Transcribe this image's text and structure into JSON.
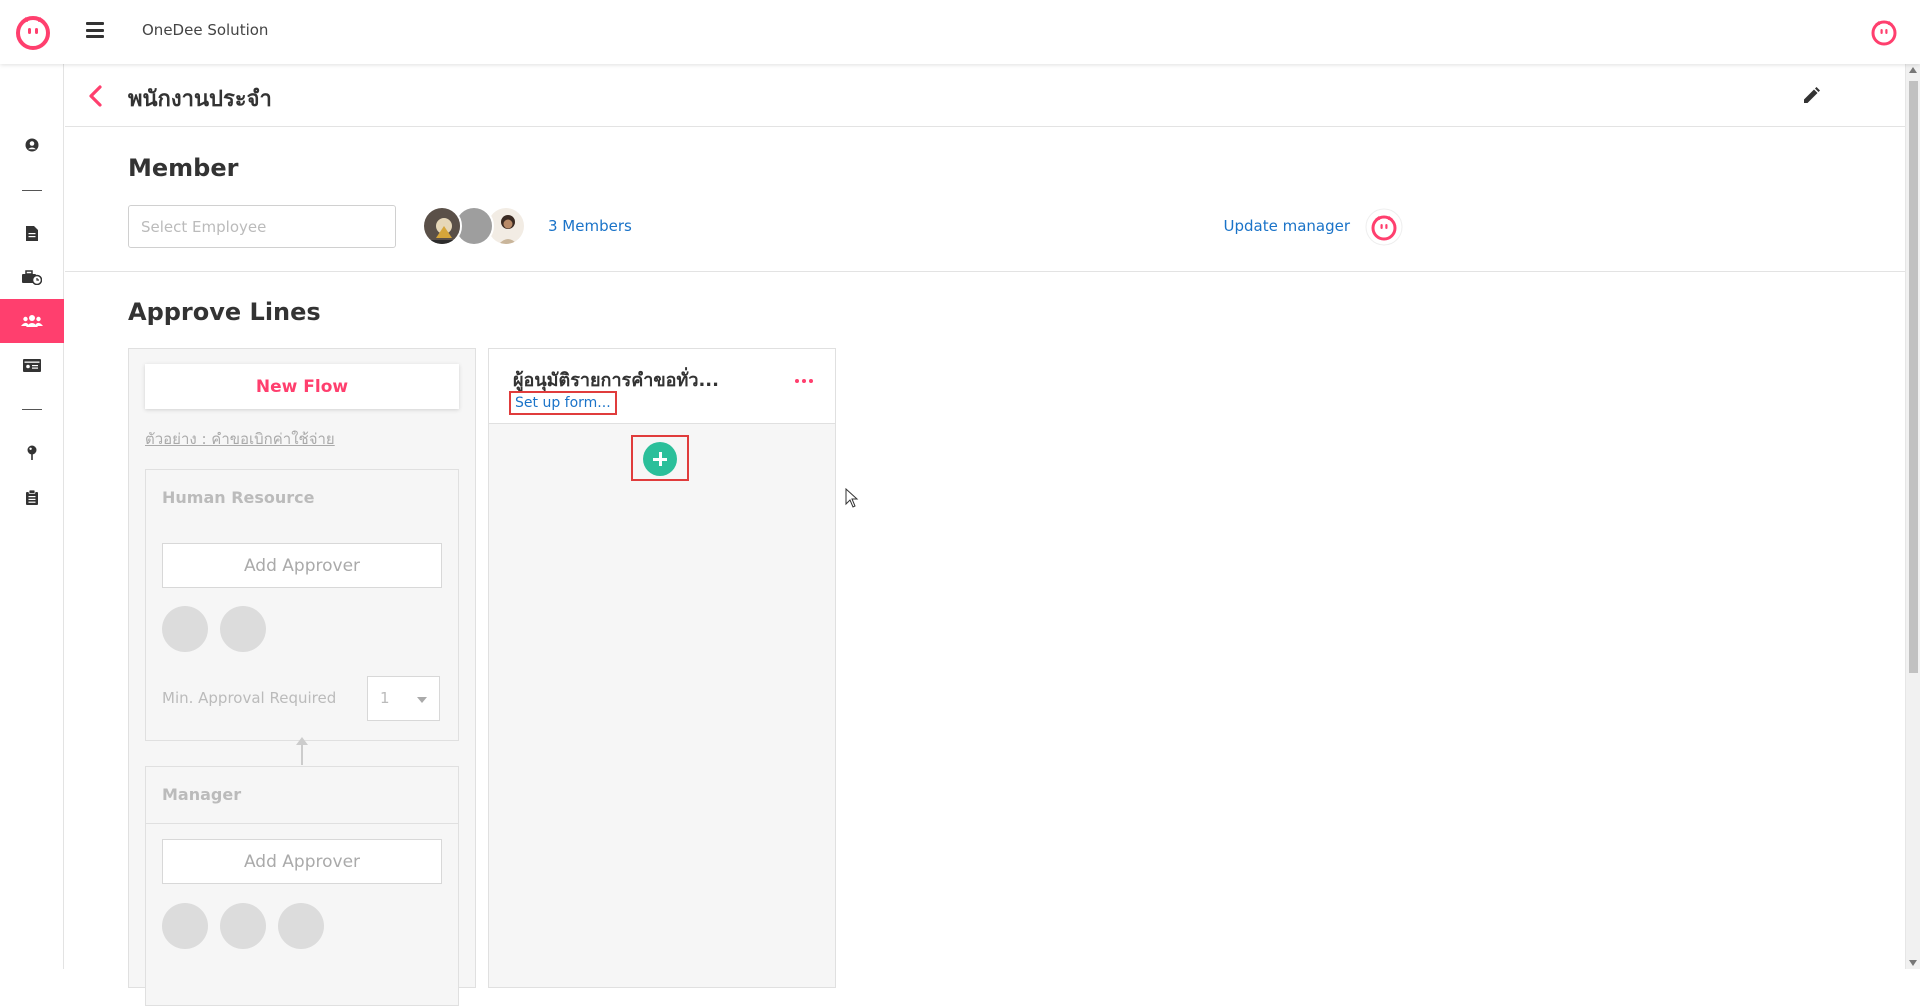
{
  "app": {
    "title": "OneDee Solution",
    "brand_color": "#ff3f6e",
    "accent_green": "#2bbf9a",
    "link_color": "#1a73c8"
  },
  "topbar": {
    "logo_icon": "pink-face-logo",
    "menu_icon": "hamburger-menu-icon",
    "user_icon": "pink-face-avatar"
  },
  "sidebar": {
    "items": [
      {
        "icon": "user-circle-icon",
        "active": false
      },
      {
        "icon": "document-icon",
        "active": false
      },
      {
        "icon": "briefcase-clock-icon",
        "active": false
      },
      {
        "icon": "users-group-icon",
        "active": true
      },
      {
        "icon": "id-card-icon",
        "active": false
      },
      {
        "icon": "map-pin-icon",
        "active": false
      },
      {
        "icon": "clipboard-icon",
        "active": false
      }
    ]
  },
  "page": {
    "title": "พนักงานประจำ"
  },
  "member": {
    "heading": "Member",
    "select_placeholder": "Select Employee",
    "members_count_label": "3 Members",
    "update_manager_label": "Update manager"
  },
  "approve": {
    "heading": "Approve Lines",
    "new_flow_label": "New Flow",
    "example_label": "ตัวอย่าง : คำขอเบิกค่าใช้จ่าย",
    "example_cards": [
      {
        "title": "Human Resource",
        "add_approver_label": "Add Approver",
        "min_approval_label": "Min. Approval Required",
        "min_approval_value": "1"
      },
      {
        "title": "Manager",
        "add_approver_label": "Add Approver"
      }
    ],
    "flow": {
      "title": "ผู้อนุมัติรายการคำขอทั่ว...",
      "setup_link": "Set up form..."
    }
  }
}
